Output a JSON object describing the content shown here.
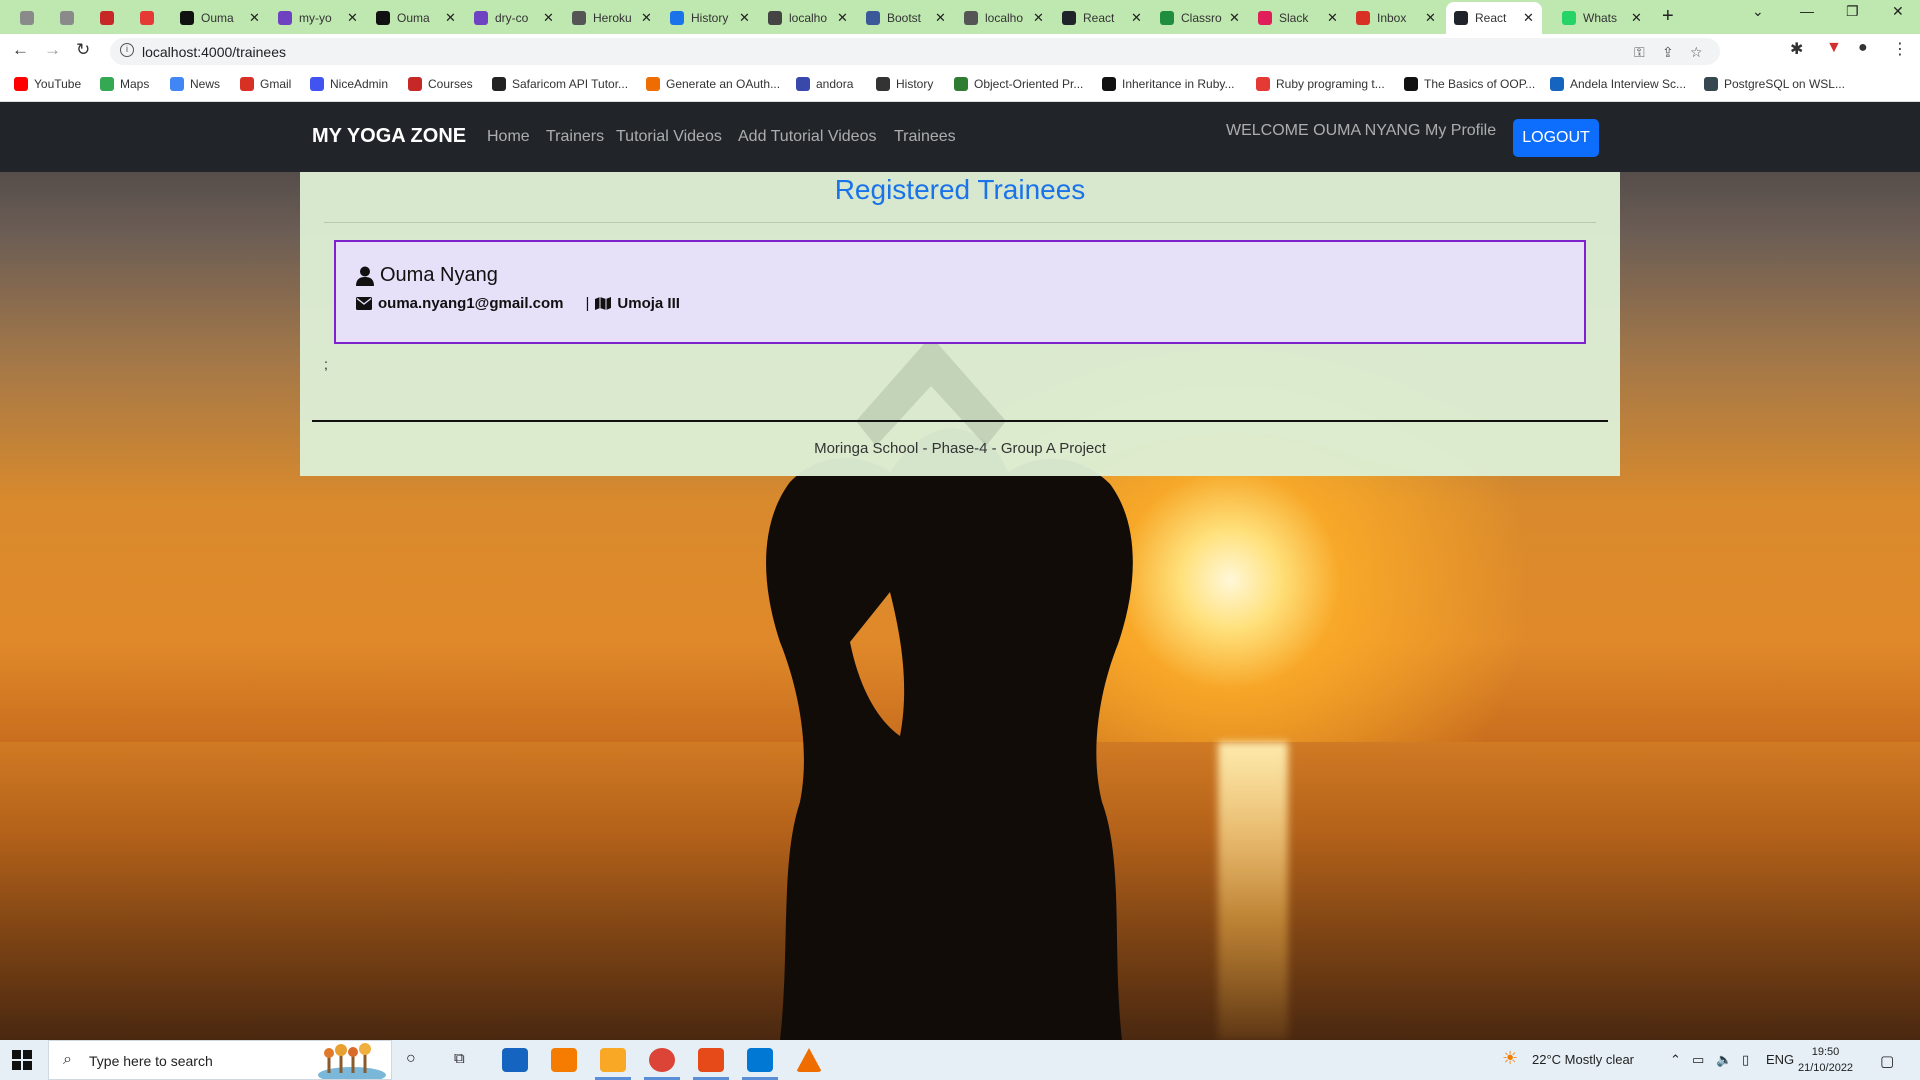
{
  "browser": {
    "tabs": [
      {
        "label": "",
        "color": "#8a8a8a"
      },
      {
        "label": "",
        "color": "#8a8a8a"
      },
      {
        "label": "",
        "color": "#c62828"
      },
      {
        "label": "",
        "color": "#e53935"
      },
      {
        "label": "Ouma",
        "color": "#111111"
      },
      {
        "label": "my-yo",
        "color": "#6f42c1"
      },
      {
        "label": "Ouma",
        "color": "#111111"
      },
      {
        "label": "dry-co",
        "color": "#6f42c1"
      },
      {
        "label": "Heroku",
        "color": "#555555"
      },
      {
        "label": "History",
        "color": "#1a73e8"
      },
      {
        "label": "localho",
        "color": "#444444"
      },
      {
        "label": "Bootst",
        "color": "#3b5998"
      },
      {
        "label": "localho",
        "color": "#555555"
      },
      {
        "label": "React",
        "color": "#20232a"
      },
      {
        "label": "Classro",
        "color": "#1e8e3e"
      },
      {
        "label": "Slack",
        "color": "#e01e5a"
      },
      {
        "label": "Inbox",
        "color": "#d93025"
      },
      {
        "label": "React",
        "color": "#20232a"
      },
      {
        "label": "Whats",
        "color": "#25d366"
      }
    ],
    "active_tab_index": 17,
    "url": "localhost:4000/trainees",
    "bookmarks": [
      {
        "label": "YouTube",
        "color": "#ff0000"
      },
      {
        "label": "Maps",
        "color": "#34a853"
      },
      {
        "label": "News",
        "color": "#4285f4"
      },
      {
        "label": "Gmail",
        "color": "#d93025"
      },
      {
        "label": "NiceAdmin",
        "color": "#4154f1"
      },
      {
        "label": "Courses",
        "color": "#c62828"
      },
      {
        "label": "Safaricom API Tutor...",
        "color": "#222222"
      },
      {
        "label": "Generate an OAuth...",
        "color": "#ef6c00"
      },
      {
        "label": "andora",
        "color": "#3949ab"
      },
      {
        "label": "History",
        "color": "#333333"
      },
      {
        "label": "Object-Oriented Pr...",
        "color": "#2e7d32"
      },
      {
        "label": "Inheritance in Ruby...",
        "color": "#111111"
      },
      {
        "label": "Ruby programing t...",
        "color": "#e53935"
      },
      {
        "label": "The Basics of OOP...",
        "color": "#111111"
      },
      {
        "label": "Andela Interview Sc...",
        "color": "#1565c0"
      },
      {
        "label": "PostgreSQL on WSL...",
        "color": "#37474f"
      }
    ]
  },
  "navbar": {
    "brand": "MY YOGA ZONE",
    "links": [
      "Home",
      "Trainers",
      "Tutorial Videos",
      "Add Tutorial Videos",
      "Trainees"
    ],
    "welcome": "WELCOME OUMA NYANG",
    "profile": "My Profile",
    "logout": "LOGOUT"
  },
  "page": {
    "title": "Registered Trainees",
    "trainee": {
      "name": "Ouma Nyang",
      "email": "ouma.nyang1@gmail.com",
      "separator": "|",
      "location": "Umoja III"
    },
    "stray_text": ";",
    "footer": "Moringa School - Phase-4 - Group A Project"
  },
  "taskbar": {
    "search_placeholder": "Type here to search",
    "weather": "22°C  Mostly clear",
    "language": "ENG",
    "time": "19:50",
    "date": "21/10/2022"
  },
  "colors": {
    "accent_blue": "#0d6efd",
    "title_blue": "#1a73e8",
    "card_border": "#7e22ce",
    "navbar_bg": "#212529"
  }
}
